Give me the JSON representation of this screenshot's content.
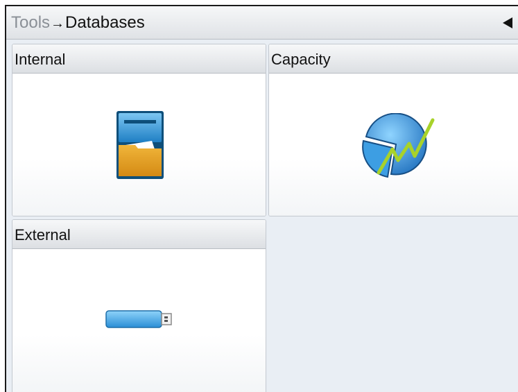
{
  "header": {
    "breadcrumb_parent": "Tools",
    "breadcrumb_separator": "→",
    "breadcrumb_current": "Databases",
    "back_icon": "triangle-left-icon"
  },
  "tiles": [
    {
      "label": "Internal",
      "icon": "file-cabinet-folder-icon"
    },
    {
      "label": "Capacity",
      "icon": "pie-chart-trend-icon"
    },
    {
      "label": "External",
      "icon": "usb-drive-icon"
    }
  ],
  "colors": {
    "background": "#e9eef4",
    "icon_blue": "#3a9fe0",
    "folder_orange": "#e3a123",
    "trend_green": "#a8d22a"
  }
}
